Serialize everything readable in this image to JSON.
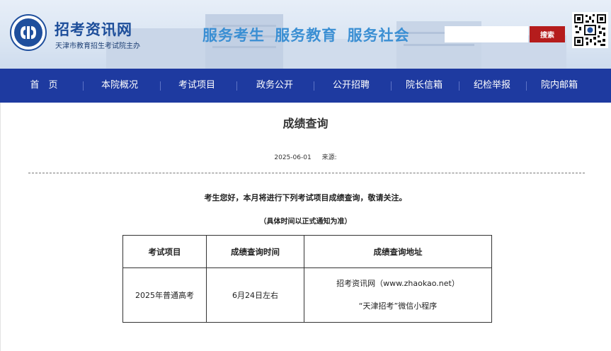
{
  "header": {
    "logo_text": "TAEA",
    "site_name": "招考资讯网",
    "site_subtitle": "天津市教育招生考试院主办",
    "slogan": "服务考生 服务教育 服务社会",
    "search": {
      "placeholder": "",
      "button_label": "搜索"
    }
  },
  "nav": {
    "items": [
      "首　页",
      "本院概况",
      "考试项目",
      "政务公开",
      "公开招聘",
      "院长信箱",
      "纪检举报",
      "院内邮箱"
    ]
  },
  "article": {
    "title": "成绩查询",
    "date": "2025-06-01",
    "source_label": "来源:",
    "intro": "考生您好，本月将进行下列考试项目成绩查询，敬请关注。",
    "note": "（具体时间以正式通知为准）",
    "table": {
      "headers": [
        "考试项目",
        "成绩查询时间",
        "成绩查询地址"
      ],
      "rows": [
        {
          "exam": "2025年普通高考",
          "time": "6月24日左右",
          "address_lines": [
            "招考资讯网（www.zhaokao.net）",
            "“天津招考”微信小程序"
          ]
        }
      ]
    }
  },
  "colors": {
    "nav_bg": "#1e3aa0",
    "brand_blue": "#1d4e9a",
    "slogan_blue": "#3b8fd3",
    "search_button": "#b51c1c"
  }
}
